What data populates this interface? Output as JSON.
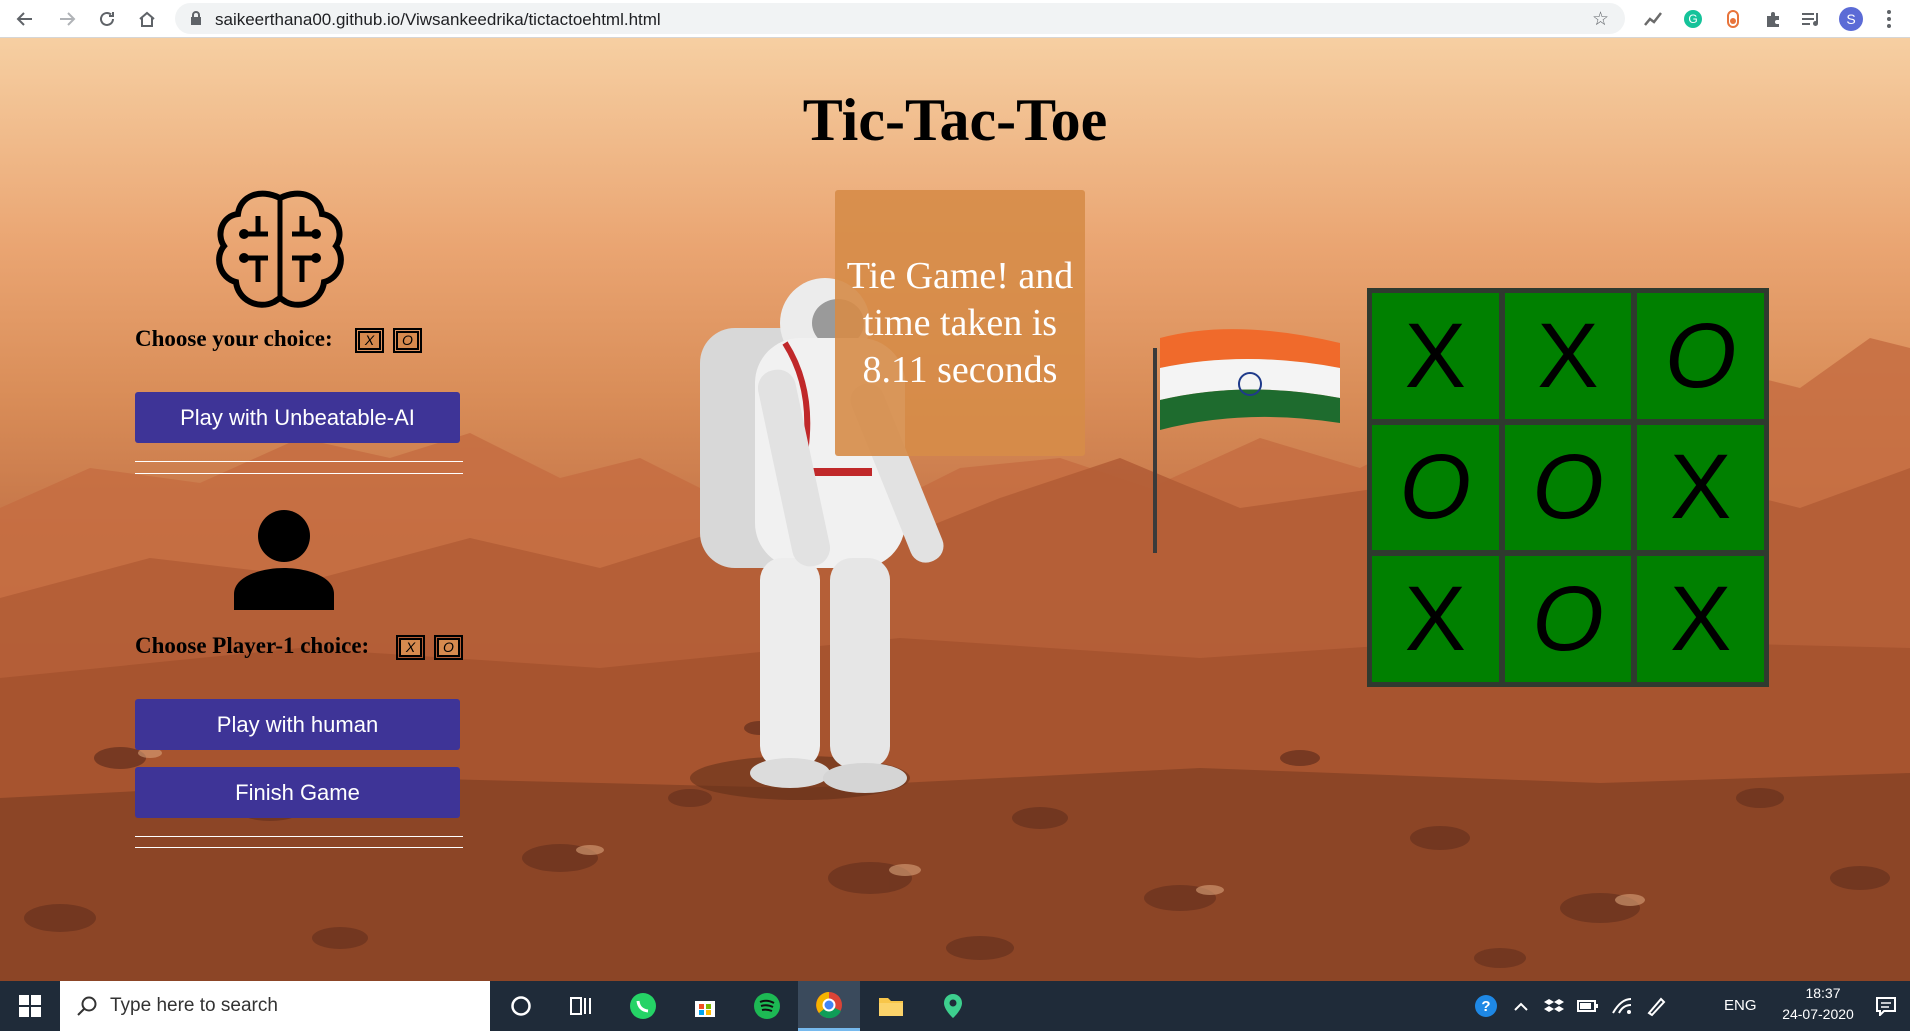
{
  "browser": {
    "url": "saikeerthana00.github.io/Viwsankeedrika/tictactoehtml.html",
    "profile_initial": "S"
  },
  "page": {
    "title": "Tic-Tac-Toe",
    "ai_section": {
      "choice_label": "Choose your choice:",
      "options": [
        "X",
        "O"
      ],
      "play_button": "Play with Unbeatable-AI"
    },
    "human_section": {
      "choice_label": "Choose Player-1 choice:",
      "options": [
        "X",
        "O"
      ],
      "play_button": "Play with human",
      "finish_button": "Finish Game"
    },
    "result_message": "Tie Game! and time taken is 8.11 seconds",
    "board": [
      "X",
      "X",
      "O",
      "O",
      "O",
      "X",
      "X",
      "O",
      "X"
    ]
  },
  "taskbar": {
    "search_placeholder": "Type here to search",
    "language": "ENG",
    "time": "18:37",
    "date": "24-07-2020"
  },
  "colors": {
    "button_bg": "#3e3497",
    "board_cell": "#008000",
    "result_box": "#d68c48",
    "taskbar_bg": "#1f2b39"
  }
}
